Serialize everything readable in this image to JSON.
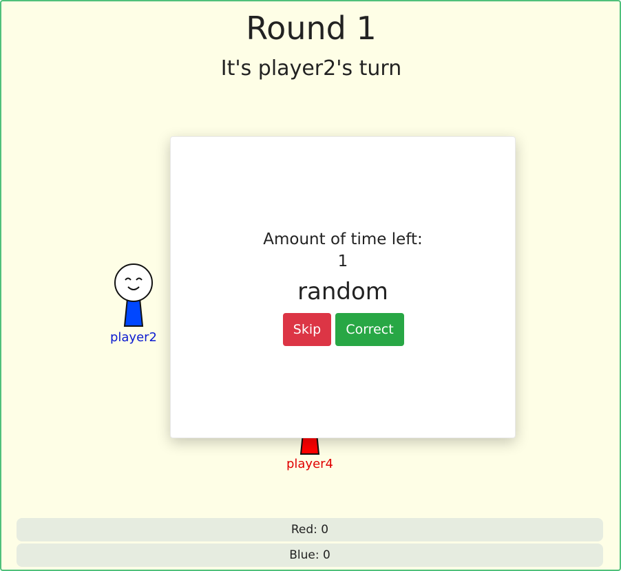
{
  "header": {
    "round_title": "Round 1",
    "turn_text": "It's player2's turn"
  },
  "players": [
    {
      "name": "player2",
      "color": "#0047ff",
      "label_color": "#0a1ad0"
    },
    {
      "name": "player4",
      "color": "#ff0000",
      "label_color": "#e00000"
    }
  ],
  "modal": {
    "time_label": "Amount of time left:",
    "time_value": "1",
    "word": "random",
    "skip_label": "Skip",
    "correct_label": "Correct"
  },
  "scores": [
    {
      "text": "Red: 0"
    },
    {
      "text": "Blue: 0"
    }
  ],
  "colors": {
    "background": "#fefee6",
    "border": "#4fc07a",
    "skip": "#dc3545",
    "correct": "#28a745"
  }
}
